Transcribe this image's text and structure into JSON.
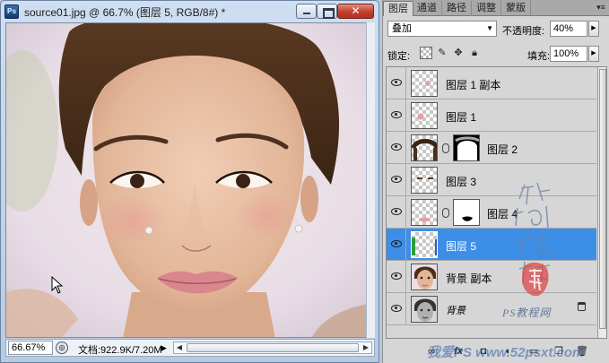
{
  "document": {
    "title": "source01.jpg @ 66.7% (图层 5, RGB/8#) *",
    "logo": "Ps",
    "close_glyph": "✕",
    "zoom": "66.67%",
    "info": "文档:922.9K/7.20M"
  },
  "panel": {
    "tabs": [
      "图层",
      "通道",
      "路径",
      "调整",
      "蒙版"
    ],
    "active_tab": "图层",
    "blend_mode": "叠加",
    "opacity_label": "不透明度:",
    "opacity_value": "40%",
    "lock_label": "锁定:",
    "fill_label": "填充:",
    "fill_value": "100%"
  },
  "layers": [
    {
      "name": "图层 1 副本",
      "visible": true,
      "has_mask": false,
      "selected": false
    },
    {
      "name": "图层 1",
      "visible": true,
      "has_mask": false,
      "selected": false
    },
    {
      "name": "图层 2",
      "visible": true,
      "has_mask": true,
      "selected": false
    },
    {
      "name": "图层 3",
      "visible": true,
      "has_mask": false,
      "selected": false
    },
    {
      "name": "图层 4",
      "visible": true,
      "has_mask": true,
      "selected": false
    },
    {
      "name": "图层 5",
      "visible": true,
      "has_mask": false,
      "selected": true
    },
    {
      "name": "背景 副本",
      "visible": true,
      "has_mask": false,
      "selected": false
    },
    {
      "name": "背景",
      "visible": true,
      "has_mask": false,
      "selected": false,
      "locked": true
    }
  ],
  "icons": {
    "footer": [
      "link-icon",
      "fx-icon",
      "mask-icon",
      "adjustment-icon",
      "group-icon",
      "new-layer-icon",
      "trash-icon"
    ]
  },
  "watermarks": {
    "calligraphy": "他拍我帮你",
    "ps_site": "PS教程网",
    "url": "我爱PS www.52psxt.com"
  },
  "colors": {
    "selection": "#3d8ee6",
    "panel_bg": "#d6d6d6",
    "title_bar": "#cfdef0"
  }
}
